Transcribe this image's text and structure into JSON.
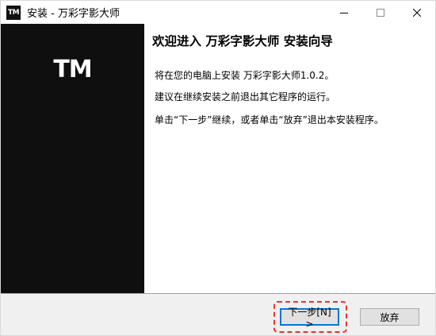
{
  "window": {
    "app_icon_text": "TM",
    "title": "安装 - 万彩字影大师"
  },
  "side_panel": {
    "logo_text": "TM"
  },
  "content": {
    "welcome_title": "欢迎进入 万彩字影大师 安装向导",
    "paragraph_1": "将在您的电脑上安装 万彩字影大师1.0.2。",
    "paragraph_2": "建议在继续安装之前退出其它程序的运行。",
    "paragraph_3": "单击“下一步”继续，或者单击“放弃”退出本安装程序。"
  },
  "buttons": {
    "next_label": "下一步[N] >",
    "cancel_label": "放弃"
  },
  "colors": {
    "side_panel": "#0f0f0f",
    "highlight": "#e8322e",
    "focus_border": "#0078d7"
  },
  "icons": {
    "minimize": "minimize-icon",
    "maximize": "maximize-icon",
    "close": "close-icon"
  }
}
